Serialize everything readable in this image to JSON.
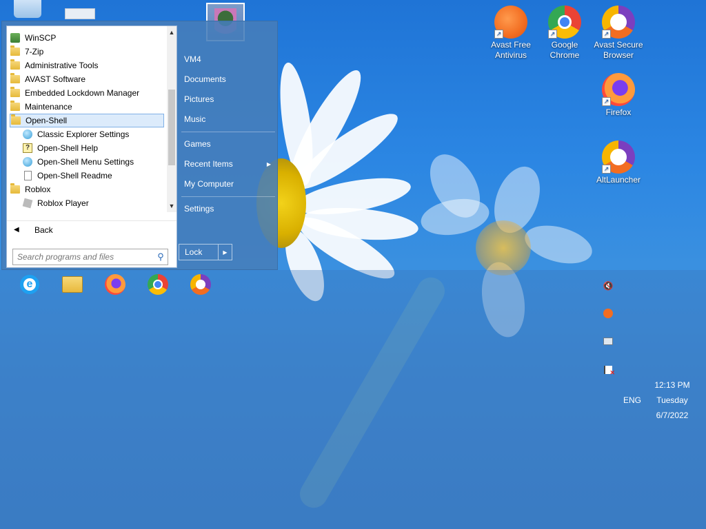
{
  "start_menu": {
    "programs": [
      {
        "label": "WinSCP",
        "icon": "winscp-icon"
      },
      {
        "label": "7-Zip",
        "icon": "folder-icon"
      },
      {
        "label": "Administrative Tools",
        "icon": "folder-icon"
      },
      {
        "label": "AVAST Software",
        "icon": "folder-icon"
      },
      {
        "label": "Embedded Lockdown Manager",
        "icon": "folder-icon"
      },
      {
        "label": "Maintenance",
        "icon": "folder-icon"
      },
      {
        "label": "Open-Shell",
        "icon": "folder-icon",
        "selected": true
      },
      {
        "label": "Classic Explorer Settings",
        "icon": "shell-icon",
        "sub": true
      },
      {
        "label": "Open-Shell Help",
        "icon": "help-icon",
        "sub": true
      },
      {
        "label": "Open-Shell Menu Settings",
        "icon": "shell-icon",
        "sub": true
      },
      {
        "label": "Open-Shell Readme",
        "icon": "document-icon",
        "sub": true
      },
      {
        "label": "Roblox",
        "icon": "folder-icon"
      },
      {
        "label": "Roblox Player",
        "icon": "roblox-icon",
        "sub": true
      }
    ],
    "back_label": "Back",
    "search_placeholder": "Search programs and files",
    "right_items": [
      "VM4",
      "Documents",
      "Pictures",
      "Music",
      "Games",
      "Recent Items",
      "My Computer",
      "Settings"
    ],
    "lock_label": "Lock"
  },
  "desktop_shortcuts": [
    {
      "label": "Avast Free Antivirus",
      "icon": "avast-icon",
      "color": "#f26d21"
    },
    {
      "label": "Google Chrome",
      "icon": "chrome-icon",
      "color": "#4285f4"
    },
    {
      "label": "Avast Secure Browser",
      "icon": "avast-secure-browser-icon",
      "color": "#7b3fbf"
    },
    {
      "label": "Firefox",
      "icon": "firefox-icon",
      "color": "#ff7139"
    },
    {
      "label": "AltLauncher",
      "icon": "altlauncher-icon",
      "color": "#7b3fbf"
    }
  ],
  "taskbar": {
    "pinned": [
      "internet-explorer-icon",
      "file-explorer-icon",
      "firefox-icon",
      "chrome-icon",
      "avast-secure-browser-icon"
    ],
    "tray": [
      "volume-muted-icon",
      "avast-tray-icon",
      "network-icon",
      "action-center-icon"
    ],
    "language": "ENG",
    "time": "12:13 PM",
    "day": "Tuesday",
    "date": "6/7/2022"
  }
}
